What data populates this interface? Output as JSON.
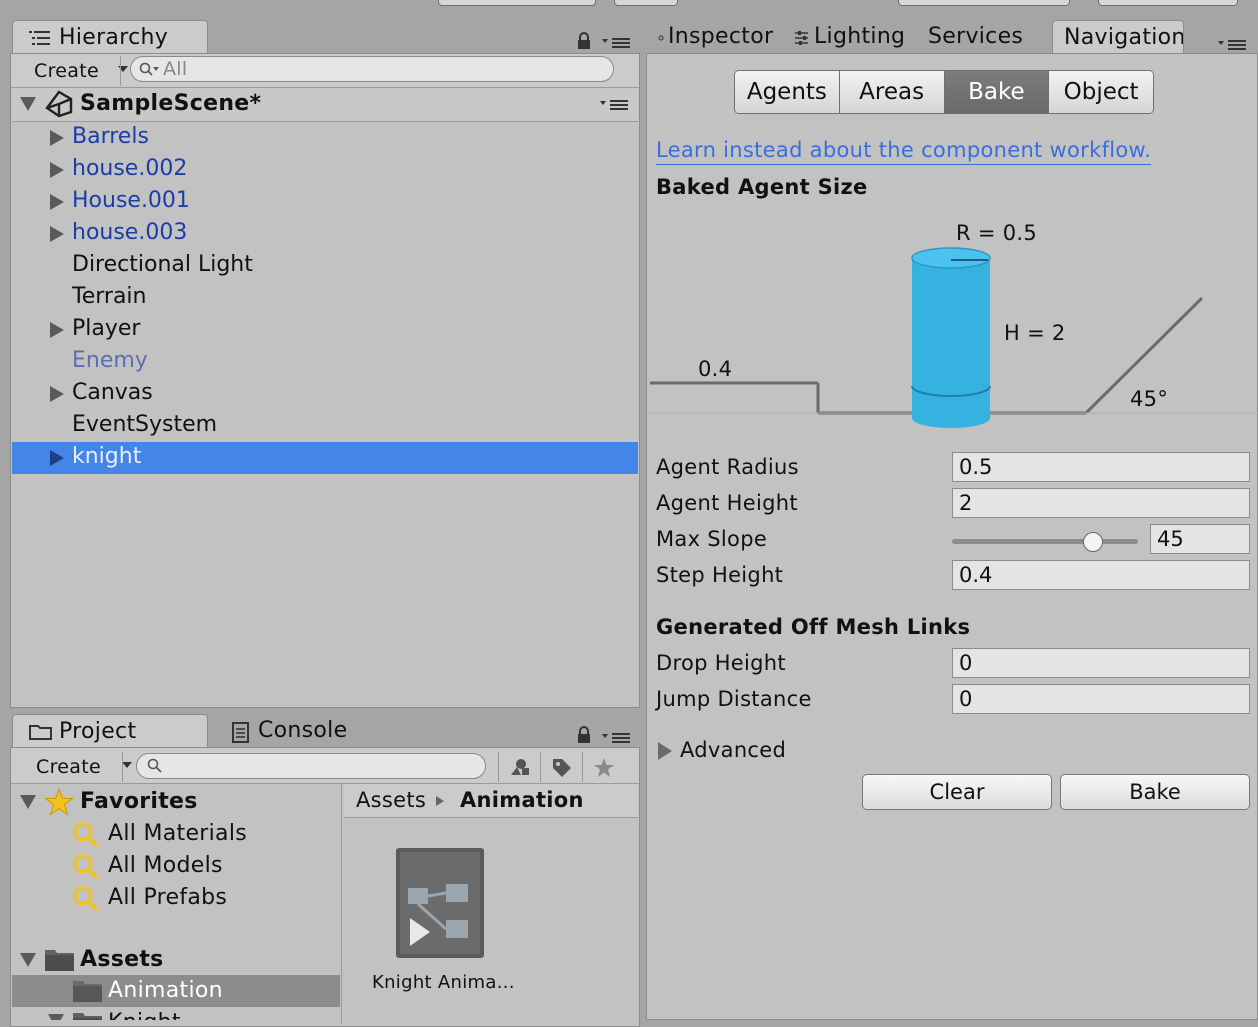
{
  "hierarchy": {
    "tab_label": "Hierarchy",
    "create_label": "Create",
    "search_placeholder": "All",
    "scene_name": "SampleScene*",
    "items": [
      {
        "label": "Barrels",
        "style": "blue",
        "expandable": true
      },
      {
        "label": "house.002",
        "style": "blue",
        "expandable": true
      },
      {
        "label": "House.001",
        "style": "blue",
        "expandable": true
      },
      {
        "label": "house.003",
        "style": "blue",
        "expandable": true
      },
      {
        "label": "Directional Light",
        "style": "normal",
        "expandable": false
      },
      {
        "label": "Terrain",
        "style": "normal",
        "expandable": false
      },
      {
        "label": "Player",
        "style": "normal",
        "expandable": true
      },
      {
        "label": "Enemy",
        "style": "lightblue",
        "expandable": false
      },
      {
        "label": "Canvas",
        "style": "normal",
        "expandable": true
      },
      {
        "label": "EventSystem",
        "style": "normal",
        "expandable": false
      },
      {
        "label": "knight",
        "style": "selected",
        "expandable": true
      }
    ]
  },
  "project": {
    "tab_label": "Project",
    "console_tab_label": "Console",
    "create_label": "Create",
    "favorites": {
      "label": "Favorites",
      "items": [
        "All Materials",
        "All Models",
        "All Prefabs"
      ]
    },
    "assets": {
      "label": "Assets",
      "items": [
        "Animation",
        "Knight"
      ]
    },
    "breadcrumb": {
      "root": "Assets",
      "current": "Animation"
    },
    "files": [
      {
        "name": "Knight Anima..."
      }
    ]
  },
  "inspector": {
    "tabs": [
      "Inspector",
      "Lighting",
      "Services",
      "Navigation"
    ],
    "active_tab": "Navigation",
    "segments": [
      "Agents",
      "Areas",
      "Bake",
      "Object"
    ],
    "active_segment": "Bake",
    "link_text": "Learn instead about the component workflow.",
    "baked_agent_size_title": "Baked Agent Size",
    "diagram": {
      "radius_label": "R = 0.5",
      "height_label": "H = 2",
      "step_label": "0.4",
      "slope_label": "45°",
      "cylinder_color": "#35b2e0"
    },
    "fields": [
      {
        "label": "Agent Radius",
        "value": "0.5"
      },
      {
        "label": "Agent Height",
        "value": "2"
      },
      {
        "label": "Max Slope",
        "value": "45",
        "slider_fraction": 0.75
      },
      {
        "label": "Step Height",
        "value": "0.4"
      }
    ],
    "offmesh_title": "Generated Off Mesh Links",
    "offmesh_fields": [
      {
        "label": "Drop Height",
        "value": "0"
      },
      {
        "label": "Jump Distance",
        "value": "0"
      }
    ],
    "advanced_label": "Advanced",
    "clear_label": "Clear",
    "bake_label": "Bake"
  },
  "colors": {
    "selection": "#4486e8",
    "panel": "#c2c2c2",
    "link": "#3a6ed8"
  }
}
